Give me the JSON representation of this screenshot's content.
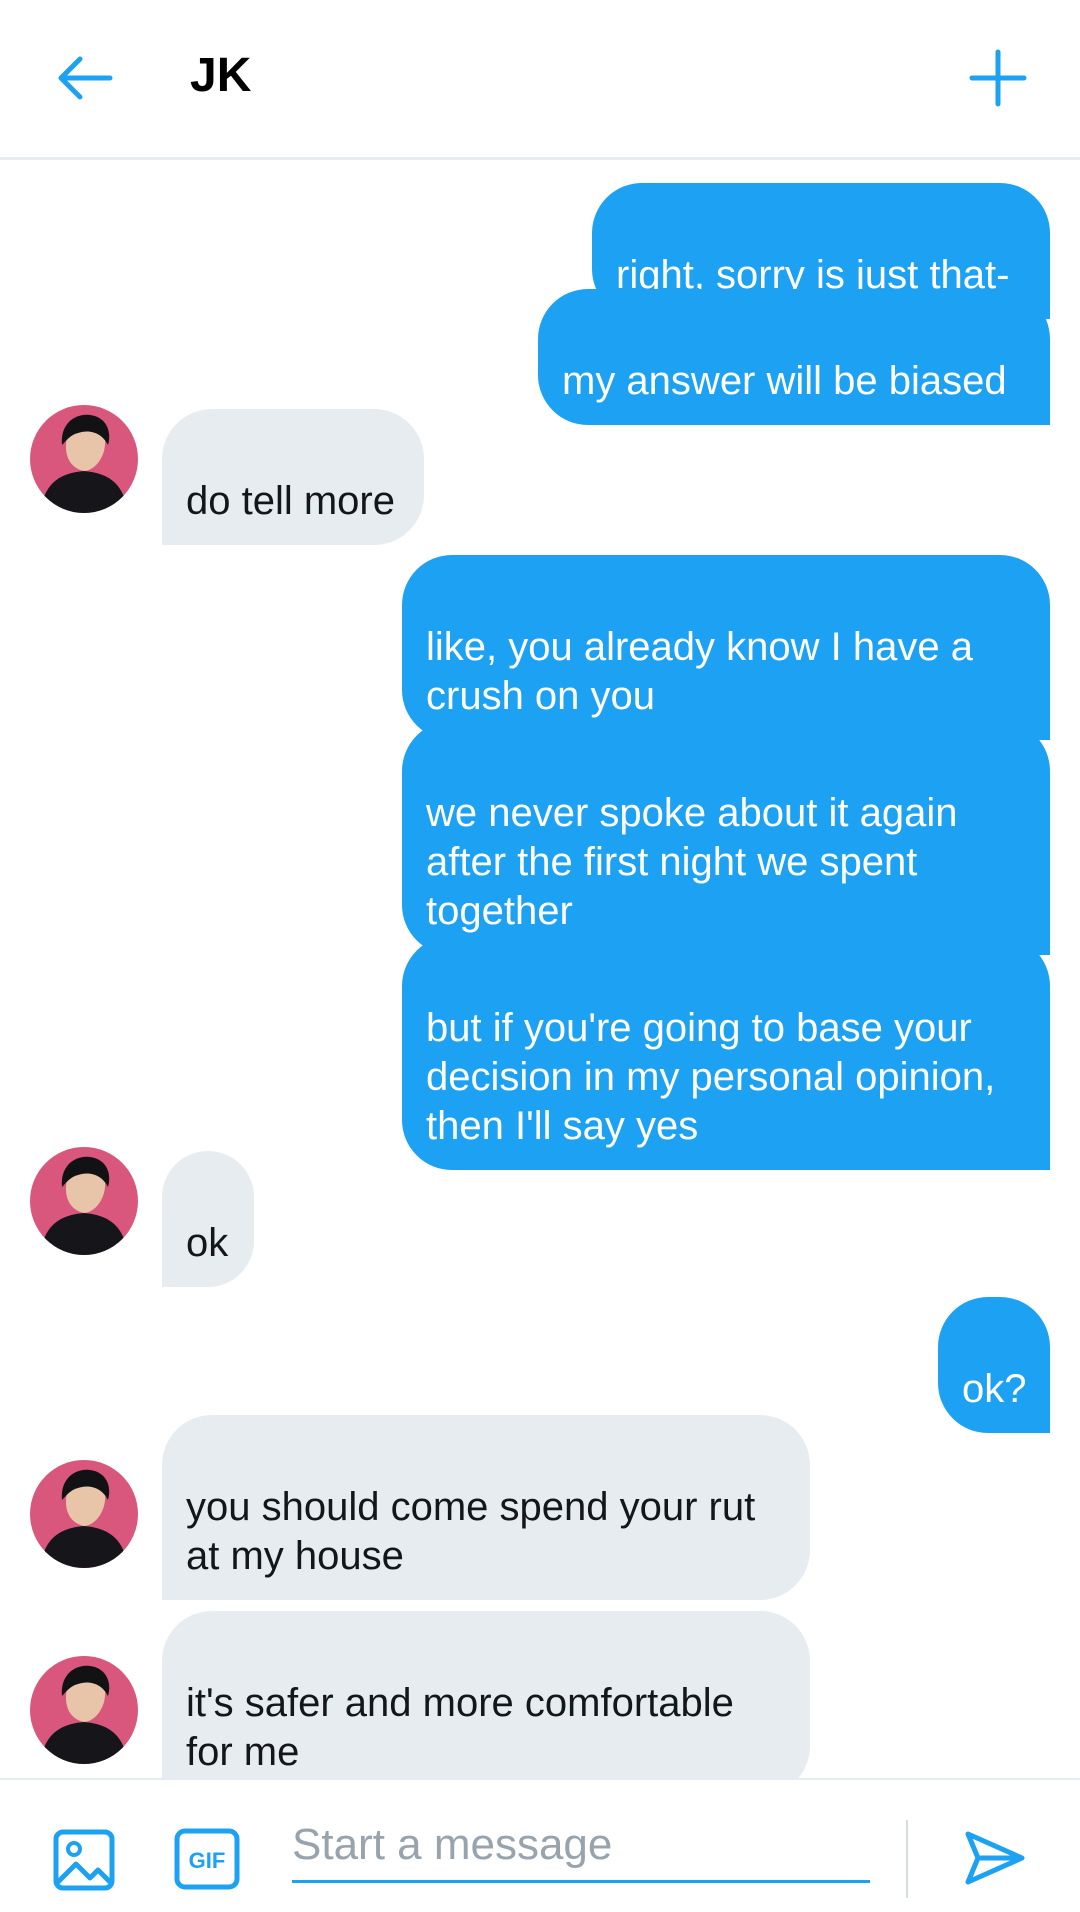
{
  "header": {
    "title": "JK",
    "back_icon": "arrow-left-icon",
    "action_icon": "plus-icon",
    "accent_color": "#1da1f2"
  },
  "messages": [
    {
      "from": "me",
      "text": "right, sorry is just that-"
    },
    {
      "from": "me",
      "text": "my answer will be biased"
    },
    {
      "from": "jk",
      "text": "do tell more"
    },
    {
      "from": "me",
      "text": "like, you already know I have  a crush on you"
    },
    {
      "from": "me",
      "text": "we never spoke about it again after the first night we spent together"
    },
    {
      "from": "me",
      "text": "but if you're going to base your decision in my personal opinion, then I'll say yes"
    },
    {
      "from": "jk",
      "text": "ok"
    },
    {
      "from": "me",
      "text": "ok?"
    },
    {
      "from": "jk",
      "text": "you should come spend your rut at my house"
    },
    {
      "from": "jk",
      "text": "it's safer and more comfortable for me"
    }
  ],
  "composer": {
    "placeholder": "Start a message",
    "gif_label": "GIF",
    "image_icon": "image-icon",
    "send_icon": "send-icon"
  },
  "colors": {
    "outgoing_bubble": "#1da1f2",
    "incoming_bubble": "#e6ecf0",
    "avatar_background": "#d9577c"
  }
}
